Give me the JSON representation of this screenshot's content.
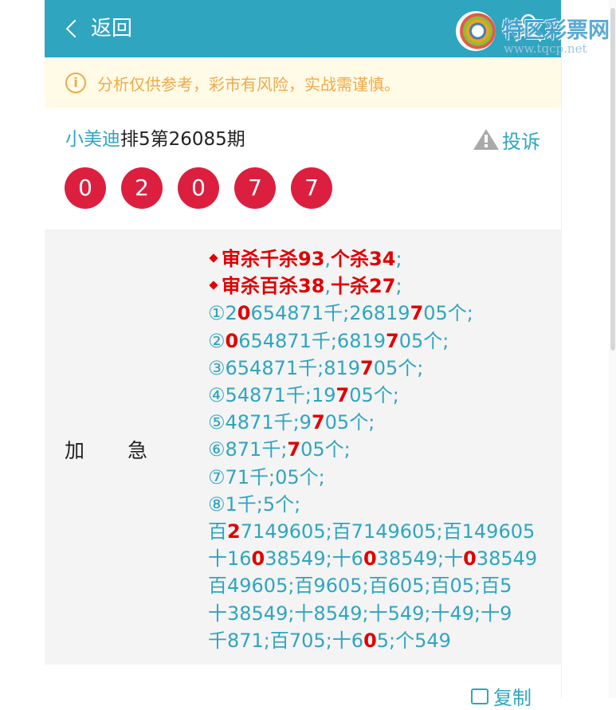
{
  "header": {
    "back_label": "返回",
    "background_color": "#2fa5c0"
  },
  "watermark": {
    "title": "特区彩票网",
    "url": "www.tqcp.net"
  },
  "notice": {
    "icon": "info-icon",
    "text": "分析仅供参考，彩市有风险，实战需谨慎。",
    "color": "#f0a94a"
  },
  "article": {
    "author": "小美迪",
    "issue": "排5第26085期",
    "complaint_label": "投诉"
  },
  "balls": [
    "0",
    "2",
    "0",
    "7",
    "7"
  ],
  "ball_color": "#dc1f3f",
  "panel": {
    "label_a": "加",
    "label_b": "急",
    "lines": [
      {
        "diamond": true,
        "parts": [
          {
            "t": "审杀千杀93",
            "s": "b"
          },
          {
            "t": ","
          },
          {
            "t": "个杀34",
            "s": "b"
          },
          {
            "t": ";"
          }
        ]
      },
      {
        "diamond": true,
        "parts": [
          {
            "t": "审杀百杀38",
            "s": "b"
          },
          {
            "t": ","
          },
          {
            "t": "十杀27",
            "s": "b"
          },
          {
            "t": ";"
          }
        ]
      },
      {
        "parts": [
          {
            "t": "①2"
          },
          {
            "t": "0",
            "s": "r"
          },
          {
            "t": "654871千;26819"
          },
          {
            "t": "7",
            "s": "r"
          },
          {
            "t": "05个;"
          }
        ]
      },
      {
        "parts": [
          {
            "t": "②"
          },
          {
            "t": "0",
            "s": "r"
          },
          {
            "t": "654871千;6819"
          },
          {
            "t": "7",
            "s": "r"
          },
          {
            "t": "05个;"
          }
        ]
      },
      {
        "parts": [
          {
            "t": "③654871千;819"
          },
          {
            "t": "7",
            "s": "r"
          },
          {
            "t": "05个;"
          }
        ]
      },
      {
        "parts": [
          {
            "t": "④54871千;19"
          },
          {
            "t": "7",
            "s": "r"
          },
          {
            "t": "05个;"
          }
        ]
      },
      {
        "parts": [
          {
            "t": "⑤4871千;9"
          },
          {
            "t": "7",
            "s": "r"
          },
          {
            "t": "05个;"
          }
        ]
      },
      {
        "parts": [
          {
            "t": "⑥871千;"
          },
          {
            "t": "7",
            "s": "r"
          },
          {
            "t": "05个;"
          }
        ]
      },
      {
        "parts": [
          {
            "t": "⑦71千;05个;"
          }
        ]
      },
      {
        "parts": [
          {
            "t": "⑧1千;5个;"
          }
        ]
      },
      {
        "parts": [
          {
            "t": "百"
          },
          {
            "t": "2",
            "s": "r"
          },
          {
            "t": "7149605;百7149605;百149605"
          }
        ]
      },
      {
        "parts": [
          {
            "t": "十16"
          },
          {
            "t": "0",
            "s": "r"
          },
          {
            "t": "38549;十6"
          },
          {
            "t": "0",
            "s": "r"
          },
          {
            "t": "38549;十"
          },
          {
            "t": "0",
            "s": "r"
          },
          {
            "t": "38549"
          }
        ]
      },
      {
        "parts": [
          {
            "t": "百49605;百9605;百605;百05;百5"
          }
        ]
      },
      {
        "parts": [
          {
            "t": "十38549;十8549;十549;十49;十9"
          }
        ]
      },
      {
        "parts": [
          {
            "t": "千871;百705;十6"
          },
          {
            "t": "0",
            "s": "r"
          },
          {
            "t": "5;个549"
          }
        ]
      }
    ]
  },
  "copy_label": "复制"
}
